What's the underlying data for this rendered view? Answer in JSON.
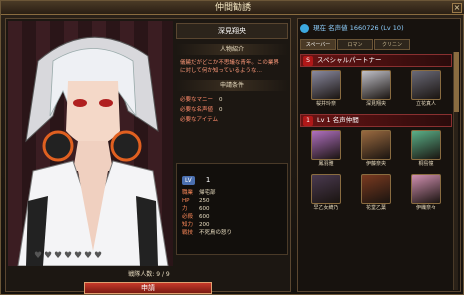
{
  "window": {
    "title": "仲間勧誘",
    "close_label": "×"
  },
  "character": {
    "name": "深見翔央",
    "profile_header": "人物紹介",
    "profile_text": "儀饒だがどこか不思議な青年。この業界に対して何か知っているような…",
    "conditions_header": "申請条件",
    "conditions": [
      {
        "label": "必要なマニー",
        "value": "0"
      },
      {
        "label": "必要な名声値",
        "value": "0"
      },
      {
        "label": "必要なアイテム",
        "value": ""
      }
    ],
    "level_badge": "LV",
    "level": "1",
    "stats": [
      {
        "label": "職業",
        "value": "帰宅部"
      },
      {
        "label": "HP",
        "value": "250"
      },
      {
        "label": "力",
        "value": "600"
      },
      {
        "label": "必殺",
        "value": "600"
      },
      {
        "label": "知力",
        "value": "200"
      },
      {
        "label": "戦技",
        "value": "不死鳥の怒り"
      }
    ],
    "hearts_filled": 0,
    "hearts_total": 7
  },
  "team": {
    "count_label": "戦隊人数: 9 / 9"
  },
  "apply_button": "申請",
  "fame": {
    "label": "現在 名声値 1660726 (Lv 10)"
  },
  "tabs": [
    {
      "label": "スペーバー",
      "active": true
    },
    {
      "label": "ロマン",
      "active": false
    },
    {
      "label": "クリニン",
      "active": false
    }
  ],
  "special_section": {
    "badge": "S",
    "title": "スペシャルパートナー"
  },
  "special_partners": [
    {
      "name": "桜井玲奈",
      "color": "#8a8aa0"
    },
    {
      "name": "深見翔央",
      "color": "#c0c0c8"
    },
    {
      "name": "立花真人",
      "color": "#6a6a78"
    }
  ],
  "lv1_section": {
    "badge": "1",
    "title": "Lv 1 名声仲間"
  },
  "lv1_partners": [
    {
      "name": "鳳羽雅",
      "color": "#b070c0"
    },
    {
      "name": "伊藤奈央",
      "color": "#9a6a40"
    },
    {
      "name": "桐島憧",
      "color": "#5ab088"
    },
    {
      "name": "早乙女綺乃",
      "color": "#4a3a50"
    },
    {
      "name": "花堂乙葉",
      "color": "#7a3a20"
    },
    {
      "name": "伊織奈々",
      "color": "#d090b0"
    }
  ]
}
